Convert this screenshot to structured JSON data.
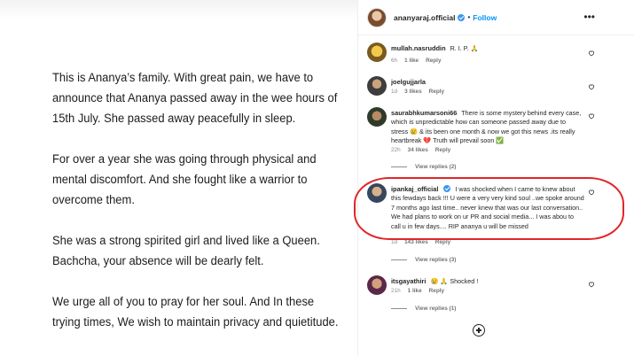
{
  "post": {
    "paragraphs": [
      "This is Ananya’s family. With great pain, we have to announce that Ananya passed away in the wee hours of 15th July. She passed away peacefully in sleep.",
      "For over a year she was going through physical and mental discomfort. And she fought like a warrior to overcome them.",
      "She was a strong spirited girl and lived like a Queen. Bachcha, your absence will be dearly felt.",
      "We urge all of you to pray for her soul. And In these trying times, We wish to maintain privacy and quietitude."
    ]
  },
  "header": {
    "username": "ananyaraj.official",
    "dot": "•",
    "follow_label": "Follow",
    "more_icon": "•••"
  },
  "comments": [
    {
      "username": "mullah.nasruddin",
      "text": "R. I. P. 🙏",
      "time": "6h",
      "likes": "1 like",
      "reply": "Reply"
    },
    {
      "username": "joelgujjarla",
      "text": "",
      "time": "1d",
      "likes": "3 likes",
      "reply": "Reply"
    },
    {
      "username": "saurabhkumarsoni66",
      "text": "There is some mystery behind every case, which is unpredictable how can someone passed away due to stress 😢 & its been one month & now we got this news .its really heartbreak 💔 Truth will prevail soon ✅",
      "time": "22h",
      "likes": "34 likes",
      "reply": "Reply",
      "view_replies": "View replies (2)"
    },
    {
      "username": "ipankaj_official",
      "text": "I was shocked when I came to knew about this fewdays back !!! U were a very very kind soul ..we spoke around 7 months ago last time.. never knew that was our last conversation.. We had plans to work on ur PR and social media... I was abou to call u in few days.... RIP ananya u will be missed",
      "time": "1d",
      "likes": "143 likes",
      "reply": "Reply",
      "view_replies": "View replies (3)"
    },
    {
      "username": "itsgayathiri",
      "text": "😢 🙏 Shocked !",
      "time": "21h",
      "likes": "1 like",
      "reply": "Reply",
      "view_replies": "View replies (1)"
    }
  ],
  "colors": {
    "accent": "#0095f6",
    "verified": "#3897f0",
    "highlight": "#e0262a"
  },
  "icons": {
    "heart": "heart-icon",
    "add": "add-comment-icon",
    "more": "more-options-icon"
  }
}
